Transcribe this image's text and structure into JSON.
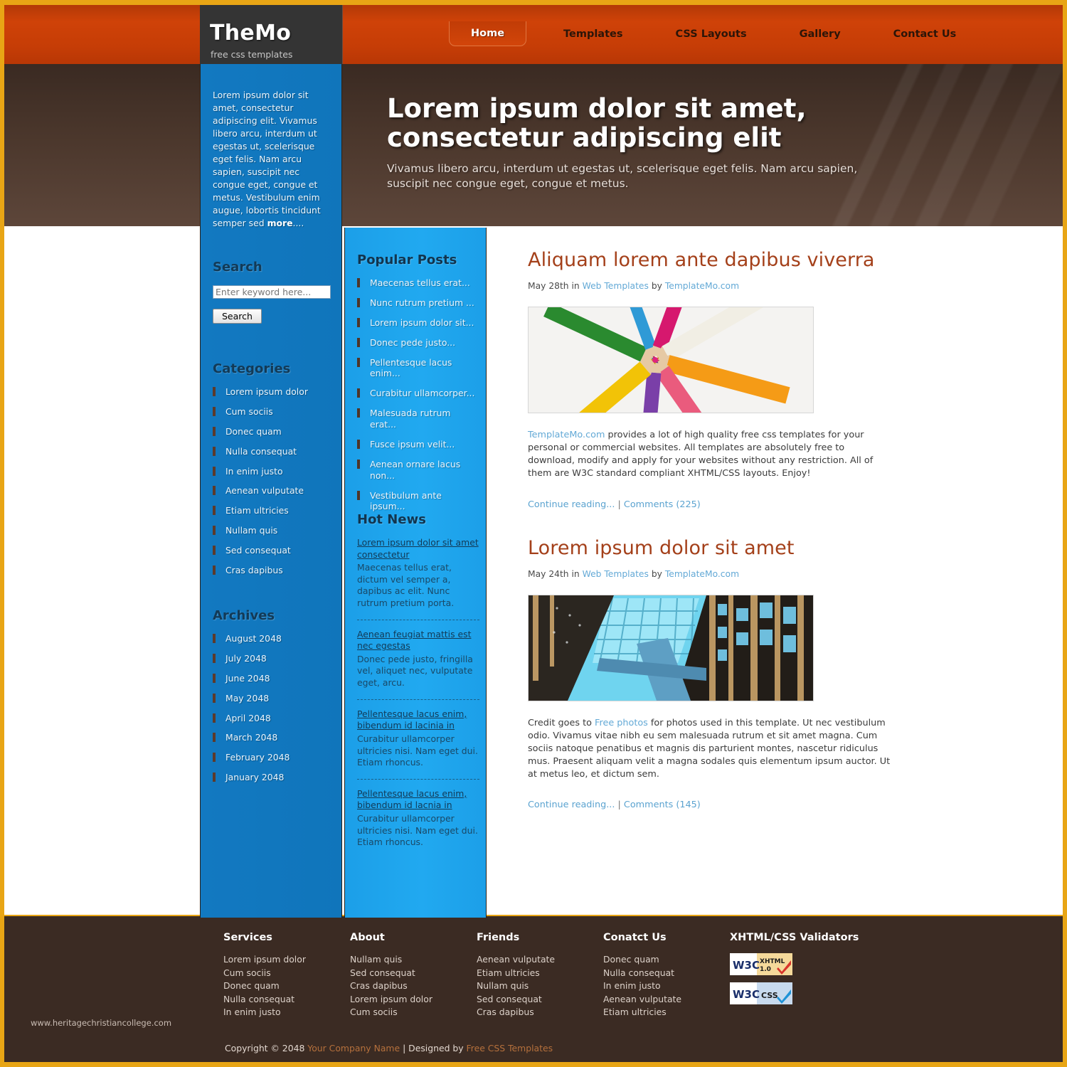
{
  "brand": {
    "title": "TheMo",
    "tagline": "free css templates"
  },
  "nav": {
    "items": [
      {
        "label": "Home",
        "active": true
      },
      {
        "label": "Templates",
        "active": false
      },
      {
        "label": "CSS Layouts",
        "active": false
      },
      {
        "label": "Gallery",
        "active": false
      },
      {
        "label": "Contact Us",
        "active": false
      }
    ]
  },
  "banner": {
    "heading": "Lorem ipsum dolor sit amet, consectetur adipiscing elit",
    "subtext": "Vivamus libero arcu, interdum ut egestas ut, scelerisque eget felis. Nam arcu sapien, suscipit nec congue eget, congue et metus."
  },
  "sidebar_left": {
    "intro_text": "Lorem ipsum dolor sit amet, consectetur adipiscing elit. Vivamus libero arcu, interdum ut egestas ut, scelerisque eget felis. Nam arcu sapien, suscipit nec congue eget, congue et metus. Vestibulum enim augue, lobortis tincidunt semper sed ",
    "intro_more": "more",
    "intro_more_suffix": "....",
    "search": {
      "heading": "Search",
      "placeholder": "Enter keyword here...",
      "value": "",
      "button_label": "Search"
    },
    "categories": {
      "heading": "Categories",
      "items": [
        "Lorem ipsum dolor",
        "Cum sociis",
        "Donec quam",
        "Nulla consequat",
        "In enim justo",
        "Aenean vulputate",
        "Etiam ultricies",
        "Nullam quis",
        "Sed consequat",
        "Cras dapibus"
      ]
    },
    "archives": {
      "heading": "Archives",
      "items": [
        "August 2048",
        "July 2048",
        "June 2048",
        "May 2048",
        "April 2048",
        "March 2048",
        "February 2048",
        "January 2048"
      ]
    }
  },
  "sidebar_mid": {
    "popular_posts": {
      "heading": "Popular Posts",
      "items": [
        "Maecenas tellus erat...",
        "Nunc rutrum pretium ...",
        "Lorem ipsum dolor sit...",
        "Donec pede justo...",
        "Pellentesque lacus enim...",
        "Curabitur ullamcorper...",
        "Malesuada rutrum erat...",
        "Fusce ipsum velit...",
        "Aenean ornare lacus non...",
        "Vestibulum ante ipsum..."
      ]
    },
    "hot_news": {
      "heading": "Hot News",
      "items": [
        {
          "title": "Lorem ipsum dolor sit amet consectetur",
          "body": "Maecenas tellus erat, dictum vel semper a, dapibus ac elit. Nunc rutrum pretium porta."
        },
        {
          "title": "Aenean feugiat mattis est nec egestas",
          "body": "Donec pede justo, fringilla vel, aliquet nec, vulputate eget, arcu."
        },
        {
          "title": "Pellentesque lacus enim, bibendum id lacinia in",
          "body": "Curabitur ullamcorper ultricies nisi. Nam eget dui. Etiam rhoncus."
        },
        {
          "title": "Pellentesque lacus enim, bibendum id lacnia in",
          "body": "Curabitur ullamcorper ultricies nisi. Nam eget dui. Etiam rhoncus."
        }
      ]
    }
  },
  "articles": [
    {
      "title": "Aliquam lorem ante dapibus viverra",
      "meta_date": "May 28th",
      "meta_in": "in",
      "meta_category": "Web Templates",
      "meta_by": "by",
      "meta_author": "TemplateMo.com",
      "image_name": "colored-pencils-photo",
      "body_link": "TemplateMo.com",
      "body_text": " provides a lot of high quality free css templates for your personal or commercial websites. All templates are absolutely free to download, modify and apply for your websites without any restriction. All of them are W3C standard compliant XHTML/CSS layouts. Enjoy!",
      "continue_label": "Continue reading...",
      "separator": "|",
      "comments_label": "Comments (225)"
    },
    {
      "title": "Lorem ipsum dolor sit amet",
      "meta_date": "May 24th",
      "meta_in": "in",
      "meta_category": "Web Templates",
      "meta_by": "by",
      "meta_author": "TemplateMo.com",
      "image_name": "architecture-skylight-photo",
      "body_prefix": "Credit goes to ",
      "body_link": "Free photos",
      "body_text": " for photos used in this template. Ut nec vestibulum odio. Vivamus vitae nibh eu sem malesuada rutrum et sit amet magna. Cum sociis natoque penatibus et magnis dis parturient montes, nascetur ridiculus mus. Praesent aliquam velit a magna sodales quis elementum ipsum auctor. Ut at metus leo, et dictum sem.",
      "continue_label": "Continue reading...",
      "separator": "|",
      "comments_label": "Comments (145)"
    }
  ],
  "footer": {
    "watermark": "www.heritagechristiancollege.com",
    "columns": [
      {
        "heading": "Services",
        "items": [
          "Lorem ipsum dolor",
          "Cum sociis",
          "Donec quam",
          "Nulla consequat",
          "In enim justo"
        ]
      },
      {
        "heading": "About",
        "items": [
          "Nullam quis",
          "Sed consequat",
          "Cras dapibus",
          "Lorem ipsum dolor",
          "Cum sociis"
        ]
      },
      {
        "heading": "Friends",
        "items": [
          "Aenean vulputate",
          "Etiam ultricies",
          "Nullam quis",
          "Sed consequat",
          "Cras dapibus"
        ]
      },
      {
        "heading": "Conatct Us",
        "items": [
          "Donec quam",
          "Nulla consequat",
          "In enim justo",
          "Aenean vulputate",
          "Etiam ultricies"
        ]
      }
    ],
    "validators": {
      "heading": "XHTML/CSS Validators",
      "xhtml_label": "XHTML 1.0",
      "css_label": "CSS",
      "w3c_label": "W3C"
    },
    "copyright": {
      "prefix": "Copyright © 2048 ",
      "company": "Your Company Name",
      "middle": " | Designed by ",
      "designer": "Free CSS Templates"
    }
  },
  "colors": {
    "gold": "#e8a515",
    "header_orange": "#c63d06",
    "brown": "#3b2b23",
    "blue_left": "#1075bb",
    "blue_mid": "#21a9f0",
    "heading_red": "#a4401a",
    "link_blue": "#63a9d6"
  }
}
